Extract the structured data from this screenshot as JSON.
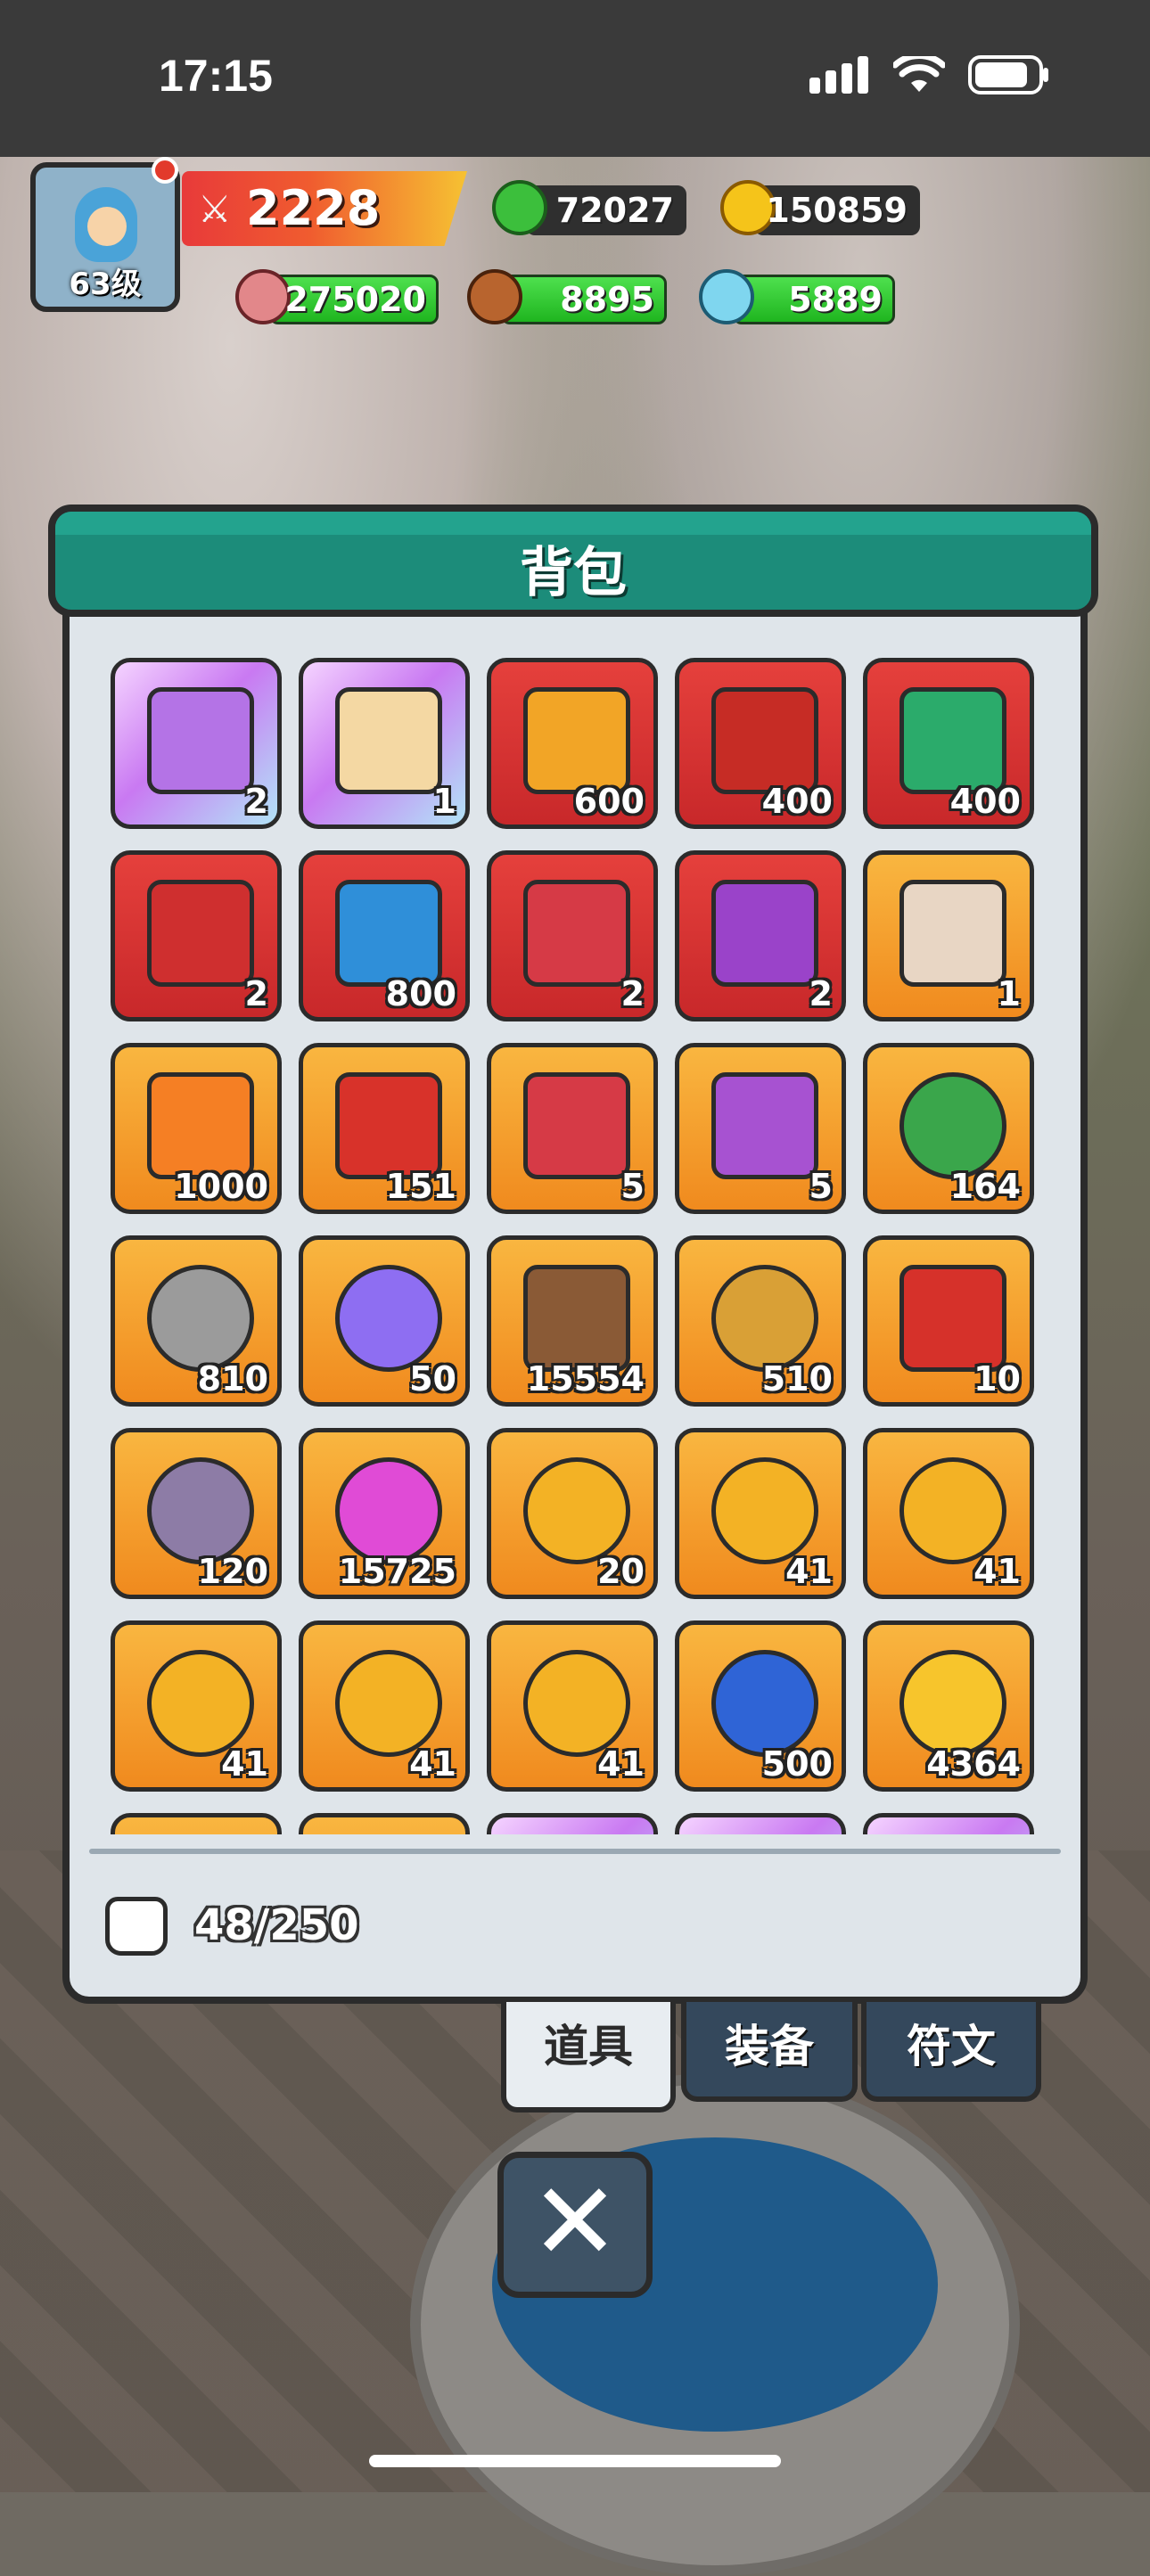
{
  "status_bar": {
    "time": "17:15"
  },
  "player": {
    "level": "63级",
    "power": "2228"
  },
  "resources": {
    "gems": "72027",
    "gold": "150859",
    "meat": "275020",
    "wood": "8895",
    "crystal": "5889"
  },
  "panel": {
    "title": "背包",
    "capacity": "48/250"
  },
  "tabs": [
    {
      "label": "道具",
      "active": true
    },
    {
      "label": "装备",
      "active": false
    },
    {
      "label": "符文",
      "active": false
    }
  ],
  "close_icon": "close-icon",
  "items": [
    {
      "icon": "heart-chest",
      "count": "2",
      "frame": "purple"
    },
    {
      "icon": "hero-portrait",
      "count": "1",
      "frame": "purple"
    },
    {
      "icon": "crown-card",
      "count": "600",
      "frame": "red"
    },
    {
      "icon": "cloud-card",
      "count": "400",
      "frame": "red"
    },
    {
      "icon": "sanguo-card",
      "count": "400",
      "frame": "red"
    },
    {
      "icon": "mystery-chest-red",
      "count": "2",
      "frame": "red"
    },
    {
      "icon": "blue-crown-chest",
      "count": "800",
      "frame": "red"
    },
    {
      "icon": "mystery-chest-open",
      "count": "2",
      "frame": "red"
    },
    {
      "icon": "purple-star-chest",
      "count": "2",
      "frame": "red"
    },
    {
      "icon": "hero-portrait-horned",
      "count": "1",
      "frame": "orange"
    },
    {
      "icon": "orange-crown-card",
      "count": "1000",
      "frame": "orange"
    },
    {
      "icon": "diamond-chest",
      "count": "151",
      "frame": "orange"
    },
    {
      "icon": "mystery-chest-open",
      "count": "5",
      "frame": "orange"
    },
    {
      "icon": "purple-mystery-chest",
      "count": "5",
      "frame": "orange"
    },
    {
      "icon": "clover",
      "count": "164",
      "frame": "orange"
    },
    {
      "icon": "stone",
      "count": "810",
      "frame": "orange"
    },
    {
      "icon": "purple-crystal",
      "count": "50",
      "frame": "orange"
    },
    {
      "icon": "hammer",
      "count": "15554",
      "frame": "orange"
    },
    {
      "icon": "winged-badge",
      "count": "510",
      "frame": "orange"
    },
    {
      "icon": "red-ticket",
      "count": "10",
      "frame": "orange"
    },
    {
      "icon": "rune-stone",
      "count": "120",
      "frame": "orange"
    },
    {
      "icon": "pink-gem",
      "count": "15725",
      "frame": "orange"
    },
    {
      "icon": "leaf-coin",
      "count": "20",
      "frame": "orange"
    },
    {
      "icon": "hat-coin",
      "count": "41",
      "frame": "orange"
    },
    {
      "icon": "sword-coin",
      "count": "41",
      "frame": "orange"
    },
    {
      "icon": "bow-coin",
      "count": "41",
      "frame": "orange"
    },
    {
      "icon": "shield-coin",
      "count": "41",
      "frame": "orange"
    },
    {
      "icon": "axe-coin",
      "count": "41",
      "frame": "orange"
    },
    {
      "icon": "blue-gem",
      "count": "500",
      "frame": "orange"
    },
    {
      "icon": "gold-crystal",
      "count": "4364",
      "frame": "orange"
    },
    {
      "icon": "partial-item",
      "count": "",
      "frame": "orange"
    },
    {
      "icon": "partial-item",
      "count": "",
      "frame": "orange"
    },
    {
      "icon": "partial-item",
      "count": "",
      "frame": "purple"
    },
    {
      "icon": "partial-item",
      "count": "",
      "frame": "purple"
    },
    {
      "icon": "partial-item",
      "count": "",
      "frame": "purple"
    }
  ],
  "colors": {
    "panel_header": "#1c8c7a",
    "panel_body": "#dfe5ea",
    "tab_inactive": "#34485c",
    "frame_orange": "#f5a02c",
    "frame_red": "#d9353a",
    "frame_purple": "#d8a5f5"
  }
}
